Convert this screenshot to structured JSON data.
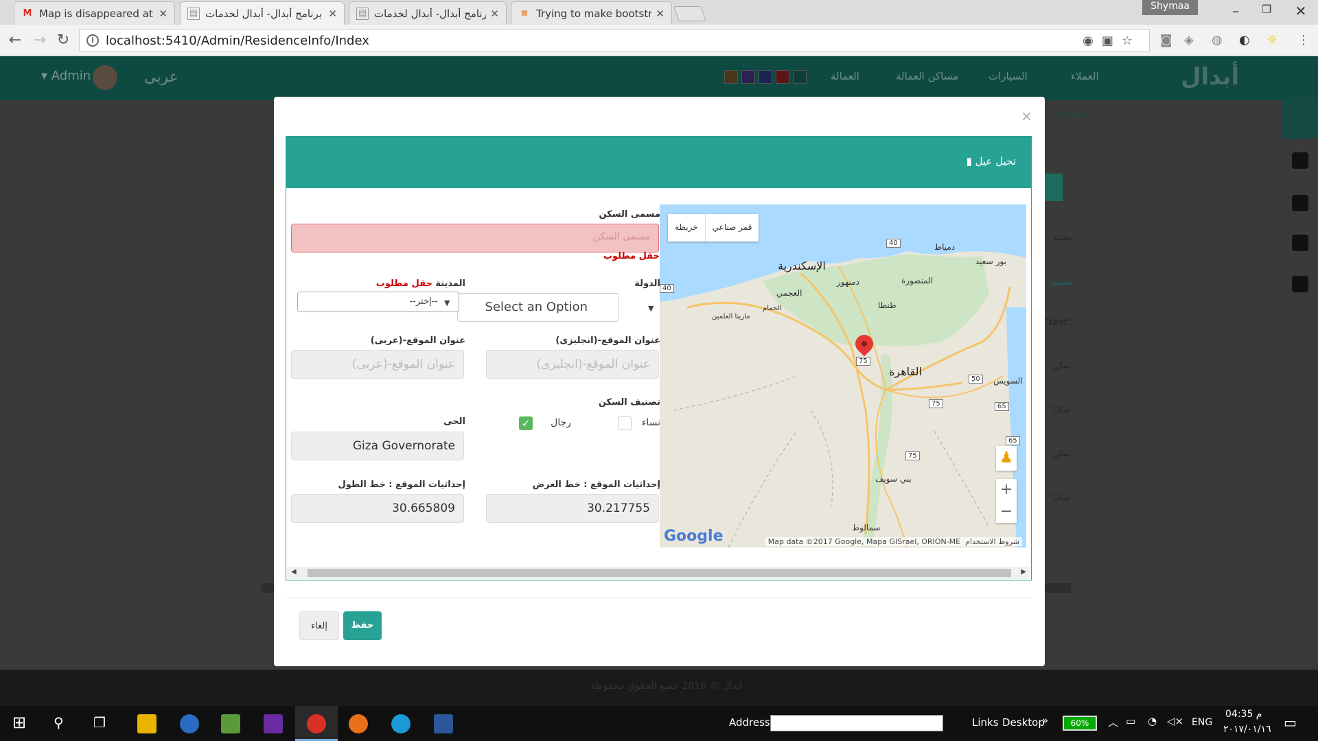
{
  "browser": {
    "tabs": [
      {
        "title": "Map is disappeared at al",
        "favicon": "gmail-icon",
        "active": false
      },
      {
        "title": "برنامج أبدال- أبدال لخدمات",
        "favicon": "page-icon",
        "active": true
      },
      {
        "title": "برنامج أبدال- أبدال لخدمات",
        "favicon": "page-icon",
        "active": false
      },
      {
        "title": "Trying to make bootstrap",
        "favicon": "stackoverflow-icon",
        "active": false
      }
    ],
    "user": "Shymaa",
    "url": "localhost:5410/Admin/ResidenceInfo/Index"
  },
  "app": {
    "nav": [
      "العملاء",
      "السيارات",
      "مساكن العمالة",
      "العمالة"
    ],
    "admin_label": "Admin",
    "language_link": "عربى",
    "footer": "أبدال © 2016 جميع الحقوق محفوظة",
    "theme_colors": [
      "#6b4b1f",
      "#3a2a6b",
      "#1e2f6b",
      "#7a1a1a",
      "#0f4a42"
    ],
    "accent": "#27a295"
  },
  "modal": {
    "header": "تحيل عيل",
    "name_label": "مسمى السكن",
    "name_placeholder": "مسمى السكن",
    "required_msg": "حقل مطلوب",
    "city_label": "المدينة",
    "city_value": "--إختر--",
    "country_label": "الدولة",
    "country_value": "Select an Option",
    "addr_ar_label": "عنوان الموقع-(عربى)",
    "addr_ar_placeholder": "عنوان الموقع-(عربى)",
    "addr_en_label": "عنوان الموقع-(انجليزى)",
    "addr_en_placeholder": "عنوان الموقع-(انجليزى)",
    "district_label": "الحى",
    "district_value": "Giza Governorate",
    "category_label": "تصنيف السكن",
    "men_label": "رجال",
    "women_label": "نساء",
    "men_checked": true,
    "women_checked": false,
    "lng_label": "إحداثيات الموقع : خط الطول",
    "lng_value": "30.665809",
    "lat_label": "إحداثيات الموقع : خط العرض",
    "lat_value": "30.217755",
    "save_label": "حفظ",
    "cancel_label": "إلغاء"
  },
  "map": {
    "type_map": "خريطة",
    "type_satellite": "قمر صناعي",
    "cities": {
      "alex": "الإسكندرية",
      "damanhur": "دمنهور",
      "mansoura": "المنصورة",
      "damietta": "دمياط",
      "portsaid": "بور سعيد",
      "tanta": "طنطا",
      "agamy": "العجمي",
      "hamam": "الحمام",
      "marina": "مارينا العلمين",
      "cairo": "القاهرة",
      "suez": "السويس",
      "benisuef": "بني سويف",
      "samalut": "سمالوط"
    },
    "shields": [
      "40",
      "40",
      "50",
      "75",
      "65",
      "65",
      "75",
      "75"
    ],
    "copyright": "Map data ©2017 Google, Mapa GISrael, ORION-ME",
    "terms": "شروط الاستخدام",
    "google": "Google",
    "zoom_in": "+",
    "zoom_out": "−"
  },
  "background": {
    "breadcrumb": "الصفحة الر",
    "search": "بحث",
    "col": "مسمى",
    "rows": [
      "\"test\"",
      "\"سكن",
      "\"سكن",
      "\"سكن",
      "\"سكن"
    ]
  },
  "taskbar": {
    "address_label": "Address",
    "links": "Links",
    "desktop": "Desktop",
    "battery": "60%",
    "lang": "ENG",
    "time": "04:35 م",
    "date": "٢٠١٧/٠١/١٦"
  }
}
